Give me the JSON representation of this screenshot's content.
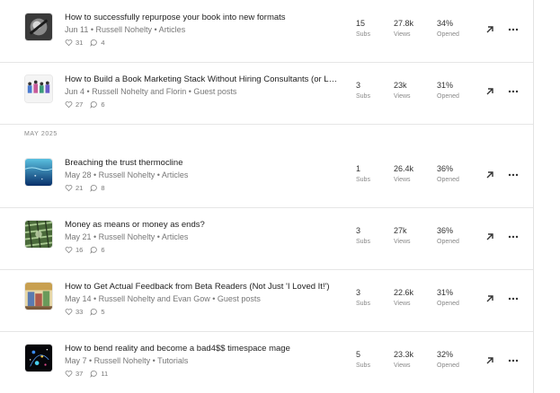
{
  "section_label": "MAY 2025",
  "labels": {
    "subs": "Subs",
    "views": "Views",
    "opened": "Opened"
  },
  "posts": [
    {
      "title": "How to successfully repurpose your book into new formats",
      "meta": "Jun 11 • Russell Nohelty • Articles",
      "likes": "31",
      "comments": "4",
      "subs": "15",
      "views": "27.8k",
      "opened": "34%",
      "thumb": "book-repurpose-thumbnail"
    },
    {
      "title": "How to Build a Book Marketing Stack Without Hiring Consultants (or Losin…",
      "meta": "Jun 4 • Russell Nohelty and Florin • Guest posts",
      "likes": "27",
      "comments": "6",
      "subs": "3",
      "views": "23k",
      "opened": "31%",
      "thumb": "marketing-stack-thumbnail"
    },
    {
      "title": "Breaching the trust thermocline",
      "meta": "May 28 • Russell Nohelty • Articles",
      "likes": "21",
      "comments": "8",
      "subs": "1",
      "views": "26.4k",
      "opened": "36%",
      "thumb": "ocean-thumbnail"
    },
    {
      "title": "Money as means or money as ends?",
      "meta": "May 21 • Russell Nohelty • Articles",
      "likes": "16",
      "comments": "6",
      "subs": "3",
      "views": "27k",
      "opened": "36%",
      "thumb": "money-thumbnail"
    },
    {
      "title": "How to Get Actual Feedback from Beta Readers (Not Just 'I Loved It!')",
      "meta": "May 14 • Russell Nohelty and Evan Gow • Guest posts",
      "likes": "33",
      "comments": "5",
      "subs": "3",
      "views": "22.6k",
      "opened": "31%",
      "thumb": "beta-readers-thumbnail"
    },
    {
      "title": "How to bend reality and become a bad4$$ timespace mage",
      "meta": "May 7 • Russell Nohelty • Tutorials",
      "likes": "37",
      "comments": "11",
      "subs": "5",
      "views": "23.3k",
      "opened": "32%",
      "thumb": "timespace-thumbnail"
    }
  ],
  "icons": {
    "like": "heart-icon",
    "comment": "comment-icon",
    "open": "arrow-up-right-icon",
    "more": "more-horizontal-icon"
  }
}
